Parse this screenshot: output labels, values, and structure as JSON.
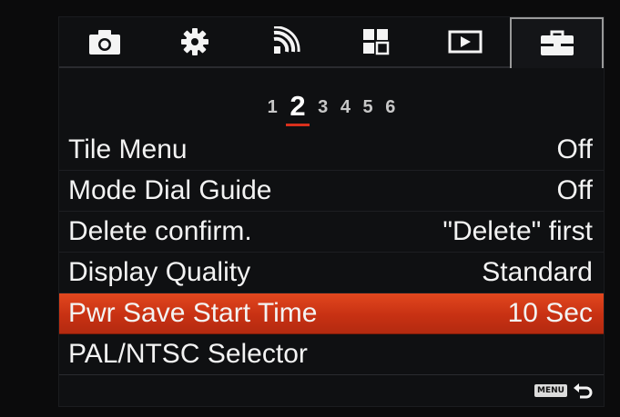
{
  "tabs": [
    {
      "icon": "camera-icon",
      "active": false
    },
    {
      "icon": "gear-icon",
      "active": false
    },
    {
      "icon": "wireless-icon",
      "active": false
    },
    {
      "icon": "application-icon",
      "active": false
    },
    {
      "icon": "playback-icon",
      "active": false
    },
    {
      "icon": "toolbox-icon",
      "active": true
    }
  ],
  "pages": [
    "1",
    "2",
    "3",
    "4",
    "5",
    "6"
  ],
  "active_page": "2",
  "menu": {
    "items": [
      {
        "label": "Tile Menu",
        "value": "Off"
      },
      {
        "label": "Mode Dial Guide",
        "value": "Off"
      },
      {
        "label": "Delete confirm.",
        "value": "\"Delete\" first"
      },
      {
        "label": "Display Quality",
        "value": "Standard"
      },
      {
        "label": "Pwr Save Start Time",
        "value": "10 Sec"
      },
      {
        "label": "PAL/NTSC Selector",
        "value": ""
      }
    ],
    "selected_index": 4
  },
  "footer": {
    "menu_key_label": "MENU",
    "back_icon": "return-arrow-icon"
  },
  "colors": {
    "accent": "#d8301c",
    "selected_row": "#c73113",
    "background": "#0f1012"
  }
}
